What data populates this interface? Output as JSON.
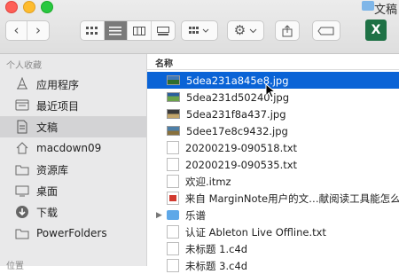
{
  "window": {
    "title": "文稿"
  },
  "toolbar": {
    "back": "‹",
    "forward": "›",
    "view_modes": [
      "icon-view",
      "list-view",
      "column-view",
      "gallery-view"
    ],
    "active_view": "list-view"
  },
  "sidebar": {
    "header": "个人收藏",
    "items": [
      {
        "label": "应用程序",
        "icon": "apps-icon"
      },
      {
        "label": "最近项目",
        "icon": "recents-icon"
      },
      {
        "label": "文稿",
        "icon": "documents-icon",
        "selected": true
      },
      {
        "label": "macdown09",
        "icon": "home-icon"
      },
      {
        "label": "资源库",
        "icon": "folder-icon"
      },
      {
        "label": "桌面",
        "icon": "desktop-icon"
      },
      {
        "label": "下载",
        "icon": "downloads-icon"
      },
      {
        "label": "PowerFolders",
        "icon": "folder-icon"
      }
    ],
    "footer": "位置"
  },
  "list": {
    "column_name": "名称",
    "rows": [
      {
        "label": "5dea231a845e8.jpg",
        "icon": "jpg",
        "selected": true
      },
      {
        "label": "5dea231d50240.jpg",
        "icon": "jpg"
      },
      {
        "label": "5dea231f8a437.jpg",
        "icon": "jpg"
      },
      {
        "label": "5dee17e8c9432.jpg",
        "icon": "jpg"
      },
      {
        "label": "20200219-090518.txt",
        "icon": "txt"
      },
      {
        "label": "20200219-090535.txt",
        "icon": "txt"
      },
      {
        "label": "欢迎.itmz",
        "icon": "doc"
      },
      {
        "label": "来自 MarginNote用户的文…献阅读工具能怎么",
        "icon": "pdf"
      },
      {
        "label": "乐谱",
        "icon": "folder",
        "disclosure": "▶"
      },
      {
        "label": "认证 Ableton Live Offline.txt",
        "icon": "txt"
      },
      {
        "label": "未标题 1.c4d",
        "icon": "doc"
      },
      {
        "label": "未标题 3.c4d",
        "icon": "doc"
      }
    ]
  }
}
